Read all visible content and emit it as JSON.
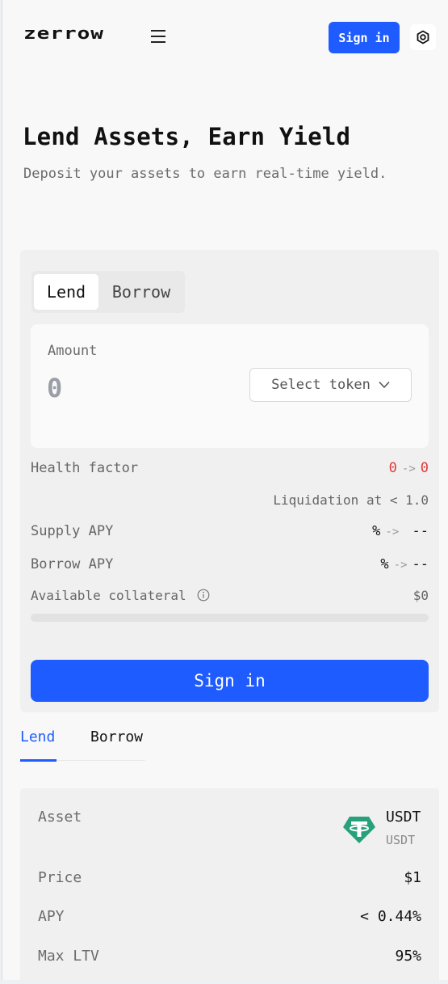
{
  "header": {
    "logo": "zerrow",
    "signin_label": "Sign in"
  },
  "hero": {
    "title": "Lend Assets, Earn Yield",
    "subtitle": "Deposit your assets to earn real-time yield."
  },
  "form": {
    "tabs": [
      "Lend",
      "Borrow"
    ],
    "active_tab": "Lend",
    "amount_label": "Amount",
    "amount_value": "0",
    "token_select_label": "Select token",
    "health_factor": {
      "label": "Health factor",
      "from": "0",
      "to": "0"
    },
    "liquidation": "Liquidation at < 1.0",
    "supply_apy": {
      "label": "Supply APY",
      "from": "%",
      "to": "--"
    },
    "borrow_apy": {
      "label": "Borrow APY",
      "from": "%",
      "to": "--"
    },
    "collateral": {
      "label": "Available collateral",
      "value": "$0",
      "progress_fraction": 0
    },
    "submit_label": "Sign in"
  },
  "market_tabs": [
    "Lend",
    "Borrow"
  ],
  "market_active_tab": "Lend",
  "asset": {
    "asset_label": "Asset",
    "symbol": "USDT",
    "sub": "USDT",
    "price_label": "Price",
    "price": "$1",
    "apy_label": "APY",
    "apy": "< 0.44%",
    "ltv_label": "Max LTV",
    "ltv": "95%"
  },
  "colors": {
    "accent": "#1f5cff",
    "danger": "#e03a3a",
    "usdt": "#26a17b"
  },
  "icons": [
    "menu-icon",
    "settings-icon",
    "chevron-down-icon",
    "info-icon",
    "usdt-icon"
  ]
}
